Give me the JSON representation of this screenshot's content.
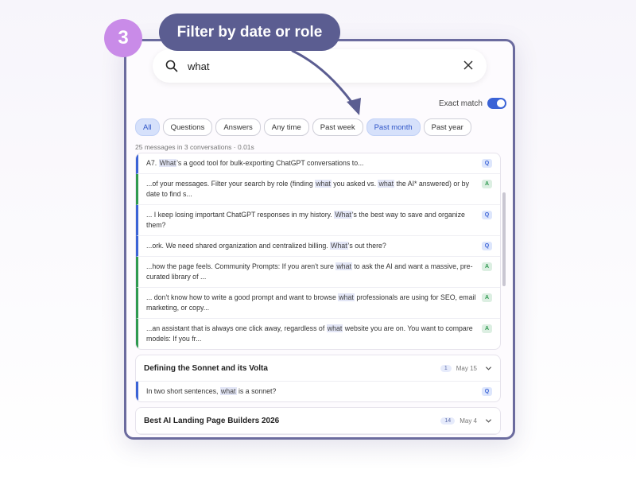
{
  "step": {
    "number": "3"
  },
  "callout": {
    "text": "Filter by date or role"
  },
  "search": {
    "value": "what"
  },
  "exact_match": {
    "label": "Exact match",
    "enabled": true
  },
  "filters": [
    {
      "label": "All",
      "active": true
    },
    {
      "label": "Questions",
      "active": false
    },
    {
      "label": "Answers",
      "active": false
    },
    {
      "label": "Any time",
      "active": false
    },
    {
      "label": "Past week",
      "active": false
    },
    {
      "label": "Past month",
      "active": true
    },
    {
      "label": "Past year",
      "active": false
    }
  ],
  "summary": "25 messages in 3 conversations · 0.01s",
  "results": [
    {
      "role": "Q",
      "before": "A7. ",
      "hit": "What",
      "after": "'s a good tool for bulk-exporting ChatGPT conversations to..."
    },
    {
      "role": "A",
      "parts": [
        "...of your messages. Filter your search by role (finding ",
        "what",
        " you asked vs. ",
        "what",
        " the AI* answered) or by date to find s..."
      ]
    },
    {
      "role": "Q",
      "before": "... I keep losing important ChatGPT responses in my history. ",
      "hit": "What",
      "after": "'s the best way to save and organize them?"
    },
    {
      "role": "Q",
      "before": "...ork. We need shared organization and centralized billing. ",
      "hit": "What",
      "after": "'s out there?"
    },
    {
      "role": "A",
      "before": "...how the page feels. Community Prompts: If you aren't sure ",
      "hit": "what",
      "after": " to ask the AI and want a massive, pre-curated library of ..."
    },
    {
      "role": "A",
      "before": "... don't know how to write a good prompt and want to browse ",
      "hit": "what",
      "after": " professionals are using for SEO, email marketing, or copy..."
    },
    {
      "role": "A",
      "before": "...an assistant that is always one click away, regardless of ",
      "hit": "what",
      "after": " website you are on. You want to compare models: If you fr..."
    }
  ],
  "conversations": [
    {
      "title": "Defining the Sonnet and its Volta",
      "count": "1",
      "date": "May 15",
      "result": {
        "role": "Q",
        "before": "In two short sentences, ",
        "hit": "what",
        "after": " is a sonnet?"
      }
    },
    {
      "title": "Best AI Landing Page Builders 2026",
      "count": "14",
      "date": "May 4"
    }
  ],
  "colors": {
    "accent": "#3b63d6",
    "answer": "#2f9950",
    "callout": "#5b5d91",
    "badge": "#c98be8",
    "frame": "#6b6b9e"
  },
  "icons": {
    "search": "search-icon",
    "clear": "close-icon",
    "expand": "chevron-down-icon"
  }
}
